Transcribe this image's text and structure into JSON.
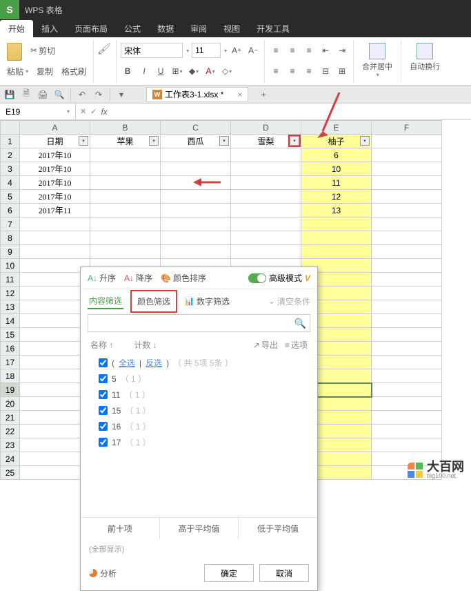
{
  "app": {
    "name": "WPS 表格"
  },
  "ribbon": {
    "tabs": [
      "开始",
      "插入",
      "页面布局",
      "公式",
      "数据",
      "审阅",
      "视图",
      "开发工具"
    ],
    "active": 0,
    "clipboard": {
      "paste": "粘贴",
      "cut": "剪切",
      "copy": "复制",
      "format_painter": "格式刷"
    },
    "font": {
      "name": "宋体",
      "size": "11"
    },
    "merge": "合并居中",
    "wrap": "自动换行"
  },
  "file_tab": {
    "name": "工作表3-1.xlsx *"
  },
  "namebox": {
    "ref": "E19"
  },
  "columns": [
    "A",
    "B",
    "C",
    "D",
    "E",
    "F"
  ],
  "headers": {
    "A": "日期",
    "B": "苹果",
    "C": "西瓜",
    "D": "雪梨",
    "E": "柚子"
  },
  "rows": [
    {
      "n": 1
    },
    {
      "n": 2,
      "A": "2017年10",
      "E": "6"
    },
    {
      "n": 3,
      "A": "2017年10",
      "E": "10"
    },
    {
      "n": 4,
      "A": "2017年10",
      "E": "11"
    },
    {
      "n": 5,
      "A": "2017年10",
      "E": "12"
    },
    {
      "n": 6,
      "A": "2017年11",
      "E": "13"
    },
    {
      "n": 7
    },
    {
      "n": 8
    },
    {
      "n": 9
    },
    {
      "n": 10
    },
    {
      "n": 11
    },
    {
      "n": 12
    },
    {
      "n": 13
    },
    {
      "n": 14
    },
    {
      "n": 15
    },
    {
      "n": 16
    },
    {
      "n": 17
    },
    {
      "n": 18
    },
    {
      "n": 19
    },
    {
      "n": 20
    },
    {
      "n": 21
    },
    {
      "n": 22
    },
    {
      "n": 23
    },
    {
      "n": 24
    },
    {
      "n": 25
    }
  ],
  "filter": {
    "sort_asc": "升序",
    "sort_desc": "降序",
    "color_sort": "颜色排序",
    "advanced": "高级模式",
    "tabs": {
      "content": "内容筛选",
      "color": "颜色筛选",
      "number": "数字筛选",
      "clear": "清空条件"
    },
    "list_header": {
      "name": "名称 ↑",
      "count": "计数 ↓",
      "export": "导出",
      "options": "选项"
    },
    "select_all": "全选",
    "invert": "反选",
    "summary": "（ 共  5项  5条 ）",
    "items": [
      {
        "v": "5",
        "c": "（ 1 ）"
      },
      {
        "v": "11",
        "c": "（ 1 ）"
      },
      {
        "v": "15",
        "c": "（ 1 ）"
      },
      {
        "v": "16",
        "c": "（ 1 ）"
      },
      {
        "v": "17",
        "c": "（ 1 ）"
      }
    ],
    "quick": {
      "top10": "前十项",
      "above_avg": "高于平均值",
      "below_avg": "低于平均值"
    },
    "status": "(全部显示)",
    "analysis": "分析",
    "ok": "确定",
    "cancel": "取消"
  },
  "watermark": {
    "cn": "大百网",
    "en": "big100.net"
  }
}
